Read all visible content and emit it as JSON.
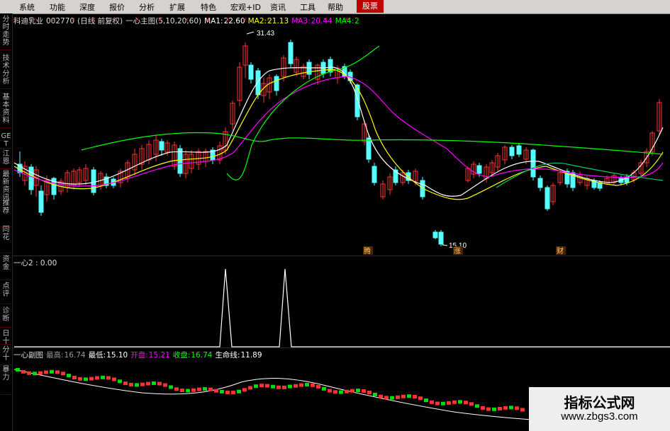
{
  "menu": {
    "items": [
      "系统",
      "功能",
      "深度",
      "报价",
      "分析",
      "扩展",
      "特色",
      "宏观+ID",
      "资讯",
      "工具",
      "帮助"
    ],
    "active": "股票"
  },
  "side_tabs": [
    "分时走势",
    "技术分析",
    "基本资料",
    "GET",
    "江恩",
    "最新资讯",
    "推荐",
    "同花",
    "资金",
    "点评",
    "诊断",
    "日十",
    "分十",
    "暴力"
  ],
  "main_panel": {
    "stock_name": "科迪乳业",
    "stock_code": "002770",
    "period": "(日线 前复权)",
    "indicator": "一心主图(5,10,20,60)",
    "ma1_label": "MA1:",
    "ma1_value": "22.60",
    "ma2_label": "MA2:",
    "ma2_value": "21.13",
    "ma3_label": "MA3:",
    "ma3_value": "20.44",
    "ma4_label": "MA4:",
    "ma4_value": "2",
    "high_label": "31.43",
    "low_label": "15.10",
    "event_marks": [
      "腾",
      "涨",
      "财"
    ]
  },
  "sub_panel1": {
    "title": "一心2 : 0.00"
  },
  "sub_panel2": {
    "title": "一心副图",
    "high_label": "最高:",
    "high_value": "16.74",
    "low_label": "最低:",
    "low_value": "15.10",
    "open_label": "开盘:",
    "open_value": "15.21",
    "close_label": "收盘:",
    "close_value": "16.74",
    "life_label": "生命线:",
    "life_value": "11.89"
  },
  "watermark": {
    "title": "指标公式网",
    "url": "www.zbgs3.com"
  },
  "colors": {
    "up": "#ff3232",
    "down": "#54ffff",
    "ma1": "#ffffff",
    "ma2": "#ffff00",
    "ma3": "#ff00ff",
    "ma4": "#00ff00",
    "divider": "#8a0000"
  }
}
